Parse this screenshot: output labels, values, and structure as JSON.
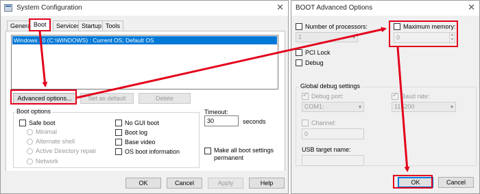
{
  "colors": {
    "accent": "#0078d7",
    "highlight_red": "#e3001b"
  },
  "icons": {
    "app": "system-config-icon",
    "close": "close-icon",
    "dropdown": "chevron-down-icon",
    "spin": "spinner-arrows-icon",
    "callout": "red-arrow"
  },
  "syscfg": {
    "title": "System Configuration",
    "close_glyph": "✕",
    "tabs": [
      "General",
      "Boot",
      "Services",
      "Startup",
      "Tools"
    ],
    "active_tab": "Boot",
    "os_list": [
      "Windows 10 (C:\\WINDOWS) : Current OS; Default OS"
    ],
    "buttons": {
      "advanced": "Advanced options...",
      "set_default": "Set as default",
      "delete": "Delete"
    },
    "boot_options": {
      "label": "Boot options",
      "safe_boot": "Safe boot",
      "minimal": "Minimal",
      "alternate_shell": "Alternate shell",
      "ad_repair": "Active Directory repair",
      "network": "Network",
      "no_gui": "No GUI boot",
      "boot_log": "Boot log",
      "base_video": "Base video",
      "os_info": "OS boot information"
    },
    "timeout": {
      "label": "Timeout:",
      "value": "30",
      "unit": "seconds"
    },
    "make_permanent": [
      "Make all boot settings",
      "permanent"
    ],
    "footer": {
      "ok": "OK",
      "cancel": "Cancel",
      "apply": "Apply",
      "help": "Help"
    }
  },
  "advanced": {
    "title": "BOOT Advanced Options",
    "close_glyph": "✕",
    "num_processors": {
      "label": "Number of processors:",
      "value": "1"
    },
    "max_memory": {
      "label": "Maximum memory:",
      "value": "0"
    },
    "pci_lock": "PCI Lock",
    "debug": "Debug",
    "global_debug": {
      "label": "Global debug settings",
      "debug_port": {
        "label": "Debug port:",
        "value": "COM1:"
      },
      "baud_rate": {
        "label": "Baud rate:",
        "value": "115200"
      },
      "channel": {
        "label": "Channel:",
        "value": "0"
      },
      "usb_target": {
        "label": "USB target name:",
        "value": ""
      }
    },
    "footer": {
      "ok": "OK",
      "cancel": "Cancel"
    }
  }
}
